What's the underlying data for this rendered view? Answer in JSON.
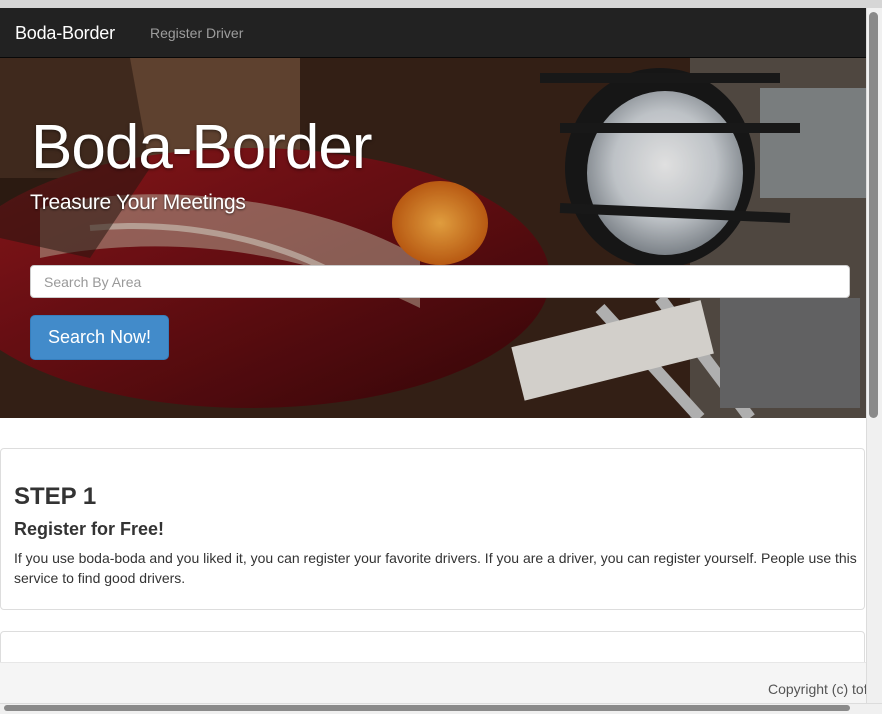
{
  "navbar": {
    "brand": "Boda-Border",
    "links": [
      {
        "label": "Register Driver"
      }
    ]
  },
  "hero": {
    "title": "Boda-Border",
    "subtitle": "Treasure Your Meetings",
    "search_placeholder": "Search By Area",
    "search_value": "",
    "search_button": "Search Now!",
    "background": "motorcycle photo (red tank with BOXER decal, headlight)"
  },
  "steps": [
    {
      "title": "STEP 1",
      "subtitle": "Register for Free!",
      "text": "If you use boda-boda and you liked it, you can register your favorite drivers. If you are a driver, you can register yourself. People use this service to find good drivers."
    }
  ],
  "footer": {
    "copyright": "Copyright (c) tofu"
  },
  "colors": {
    "navbar_bg": "#222222",
    "brand": "#ffffff",
    "navlink": "#9d9d9d",
    "primary_button": "#428bca",
    "panel_border": "#dddddd",
    "footer_bg": "#f5f5f5"
  }
}
